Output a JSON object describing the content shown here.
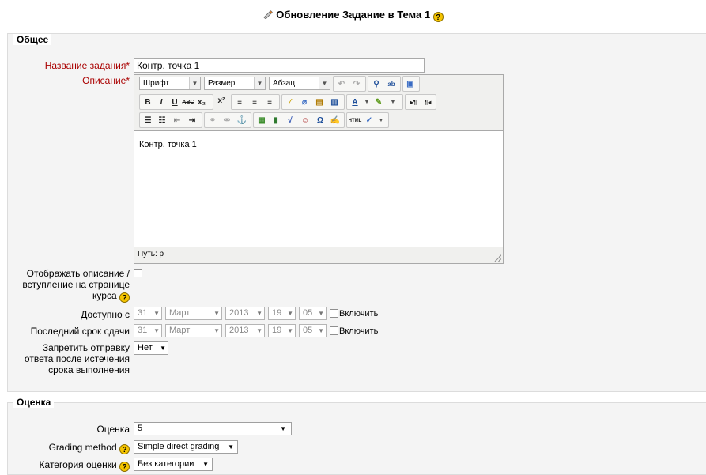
{
  "page": {
    "title": "Обновление Задание в Тема 1"
  },
  "general": {
    "legend": "Общее",
    "name_label": "Название задания",
    "name_value": "Контр. точка 1",
    "description_label": "Описание",
    "required_mark": "*",
    "editor": {
      "font_select": "Шрифт",
      "size_select": "Размер",
      "format_select": "Абзац",
      "content": "Контр. точка 1",
      "path": "Путь: p"
    },
    "show_description_label": "Отображать описание / вступление на странице курса",
    "available_from": {
      "label": "Доступно с",
      "day": "31",
      "month": "Март",
      "year": "2013",
      "hour": "19",
      "minute": "05",
      "enable_label": "Включить"
    },
    "due_date": {
      "label": "Последний срок сдачи",
      "day": "31",
      "month": "Март",
      "year": "2013",
      "hour": "19",
      "minute": "05",
      "enable_label": "Включить"
    },
    "prevent_late": {
      "label": "Запретить отправку ответа после истечения срока выполнения",
      "value": "Нет"
    }
  },
  "grading": {
    "legend": "Оценка",
    "grade_label": "Оценка",
    "grade_value": "5",
    "method_label": "Grading method",
    "method_value": "Simple direct grading",
    "category_label": "Категория оценки",
    "category_value": "Без категории"
  },
  "colors": {
    "required": "#aa0000",
    "section_bg": "#f4f4f4",
    "help_icon": "#f5c400"
  }
}
